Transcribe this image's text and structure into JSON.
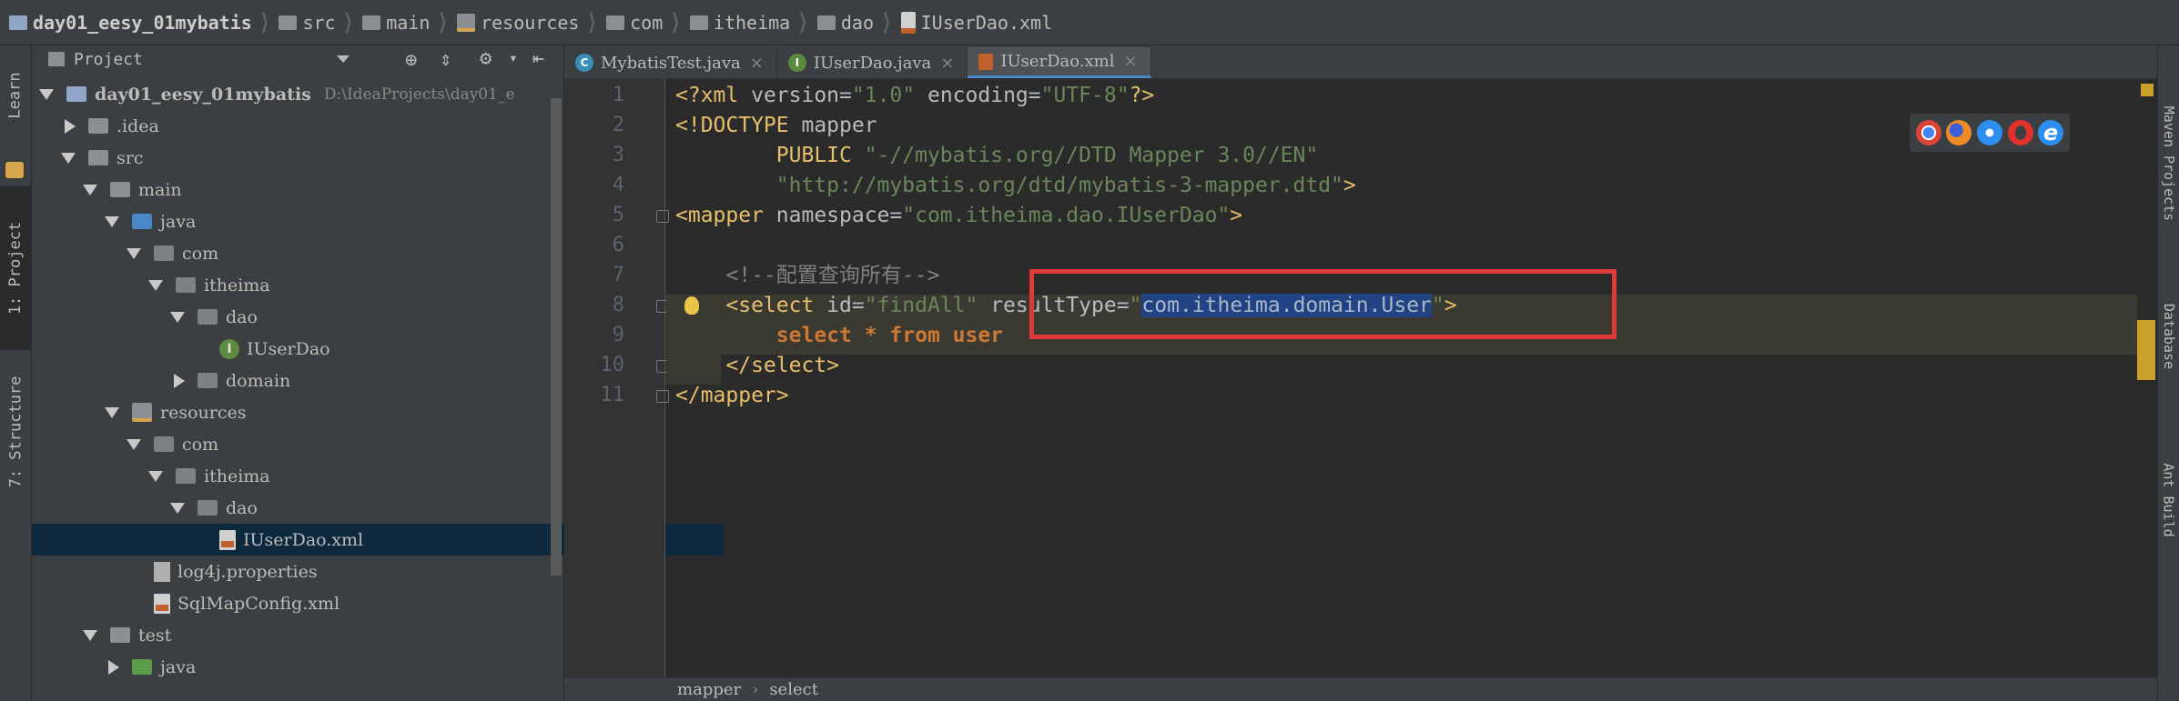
{
  "breadcrumb": [
    {
      "label": "day01_eesy_01mybatis",
      "icon": "project-folder-icon"
    },
    {
      "label": "src",
      "icon": "folder-icon"
    },
    {
      "label": "main",
      "icon": "folder-icon"
    },
    {
      "label": "resources",
      "icon": "resources-folder-icon"
    },
    {
      "label": "com",
      "icon": "folder-icon"
    },
    {
      "label": "itheima",
      "icon": "folder-icon"
    },
    {
      "label": "dao",
      "icon": "folder-icon"
    },
    {
      "label": "IUserDao.xml",
      "icon": "xml-file-icon"
    }
  ],
  "left_stripe": {
    "learn": "Learn",
    "project": "1: Project",
    "structure": "7: Structure"
  },
  "project_panel": {
    "title": "Project",
    "tree": [
      {
        "label": "day01_eesy_01mybatis",
        "hint": "D:\\IdeaProjects\\day01_e",
        "depth": 0,
        "arrow": "down",
        "icon": "project"
      },
      {
        "label": ".idea",
        "depth": 1,
        "arrow": "right",
        "icon": "folder"
      },
      {
        "label": "src",
        "depth": 1,
        "arrow": "down",
        "icon": "folder"
      },
      {
        "label": "main",
        "depth": 2,
        "arrow": "down",
        "icon": "folder"
      },
      {
        "label": "java",
        "depth": 3,
        "arrow": "down",
        "icon": "folder-blue"
      },
      {
        "label": "com",
        "depth": 4,
        "arrow": "down",
        "icon": "package"
      },
      {
        "label": "itheima",
        "depth": 5,
        "arrow": "down",
        "icon": "package"
      },
      {
        "label": "dao",
        "depth": 6,
        "arrow": "down",
        "icon": "package"
      },
      {
        "label": "IUserDao",
        "depth": 7,
        "arrow": "none",
        "icon": "interface"
      },
      {
        "label": "domain",
        "depth": 6,
        "arrow": "right",
        "icon": "package"
      },
      {
        "label": "resources",
        "depth": 3,
        "arrow": "down",
        "icon": "resources"
      },
      {
        "label": "com",
        "depth": 4,
        "arrow": "down",
        "icon": "package"
      },
      {
        "label": "itheima",
        "depth": 5,
        "arrow": "down",
        "icon": "package"
      },
      {
        "label": "dao",
        "depth": 6,
        "arrow": "down",
        "icon": "package"
      },
      {
        "label": "IUserDao.xml",
        "depth": 7,
        "arrow": "none",
        "icon": "xml",
        "selected": true
      },
      {
        "label": "log4j.properties",
        "depth": 4,
        "arrow": "none",
        "icon": "properties"
      },
      {
        "label": "SqlMapConfig.xml",
        "depth": 4,
        "arrow": "none",
        "icon": "xml"
      },
      {
        "label": "test",
        "depth": 2,
        "arrow": "down",
        "icon": "folder"
      },
      {
        "label": "java",
        "depth": 3,
        "arrow": "right",
        "icon": "folder-green"
      }
    ]
  },
  "tabs": [
    {
      "label": "MybatisTest.java",
      "icon_letter": "C",
      "icon_color": "#3a8fb7",
      "active": false
    },
    {
      "label": "IUserDao.java",
      "icon_letter": "I",
      "icon_color": "#5c8a3f",
      "active": false
    },
    {
      "label": "IUserDao.xml",
      "icon_letter": "",
      "icon_color": "#c0602c",
      "active": true
    }
  ],
  "tab_close_glyph": "×",
  "editor": {
    "line_numbers": [
      "1",
      "2",
      "3",
      "4",
      "5",
      "6",
      "7",
      "8",
      "9",
      "10",
      "11"
    ],
    "lines": [
      [
        {
          "t": "<?xml ",
          "c": "tg"
        },
        {
          "t": "version",
          "c": "at"
        },
        {
          "t": "=",
          "c": "pl"
        },
        {
          "t": "\"1.0\"",
          "c": "av"
        },
        {
          "t": " encoding",
          "c": "at"
        },
        {
          "t": "=",
          "c": "pl"
        },
        {
          "t": "\"UTF-8\"",
          "c": "av"
        },
        {
          "t": "?>",
          "c": "tg"
        }
      ],
      [
        {
          "t": "<!DOCTYPE ",
          "c": "tg"
        },
        {
          "t": "mapper",
          "c": "at"
        }
      ],
      [
        {
          "t": "        PUBLIC ",
          "c": "tg"
        },
        {
          "t": "\"-//mybatis.org//DTD Mapper 3.0//EN\"",
          "c": "av"
        }
      ],
      [
        {
          "t": "        \"http://mybatis.org/dtd/mybatis-3-mapper.dtd\"",
          "c": "av"
        },
        {
          "t": ">",
          "c": "tg"
        }
      ],
      [
        {
          "t": "<mapper ",
          "c": "tg"
        },
        {
          "t": "namespace",
          "c": "at"
        },
        {
          "t": "=",
          "c": "pl"
        },
        {
          "t": "\"com.itheima.dao.IUserDao\"",
          "c": "av"
        },
        {
          "t": ">",
          "c": "tg"
        }
      ],
      [],
      [
        {
          "t": "    <!--配置查询所有-->",
          "c": "cm"
        }
      ],
      [
        {
          "t": "    <select ",
          "c": "tg"
        },
        {
          "t": "id",
          "c": "at"
        },
        {
          "t": "=",
          "c": "pl"
        },
        {
          "t": "\"findAll\"",
          "c": "av"
        },
        {
          "t": " resultType",
          "c": "at"
        },
        {
          "t": "=",
          "c": "pl"
        },
        {
          "t": "\"",
          "c": "av"
        },
        {
          "t": "com.itheima.domain.User",
          "c": "sel"
        },
        {
          "t": "\"",
          "c": "av"
        },
        {
          "t": ">",
          "c": "tg"
        }
      ],
      [
        {
          "t": "        select * from user",
          "c": "kw"
        }
      ],
      [
        {
          "t": "    </select>",
          "c": "tg"
        }
      ],
      [
        {
          "t": "</mapper>",
          "c": "tg"
        }
      ]
    ]
  },
  "browser_icons": [
    "chrome-icon",
    "firefox-icon",
    "safari-icon",
    "opera-icon",
    "ie-icon"
  ],
  "status": {
    "path1": "mapper",
    "sep": "›",
    "path2": "select"
  },
  "right_stripe": {
    "maven": "Maven Projects",
    "database": "Database",
    "ant": "Ant Build"
  },
  "colors": {
    "selection": "#214283",
    "red_box": "#e03b3b",
    "accent": "#4a88c7"
  }
}
